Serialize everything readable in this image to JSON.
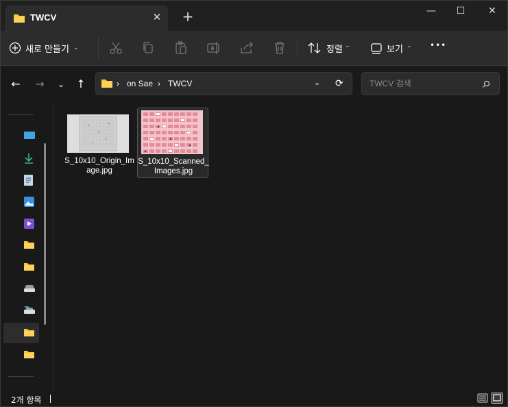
{
  "window": {
    "tab_title": "TWCV",
    "tab_close": "✕",
    "new_tab": "+",
    "minimize": "—",
    "maximize": "☐",
    "close": "✕"
  },
  "toolbar": {
    "new_label": "새로 만들기",
    "sort_label": "정렬",
    "view_label": "보기",
    "more_label": "•••"
  },
  "address": {
    "crumbs": [
      "on Sae",
      "TWCV"
    ]
  },
  "search": {
    "placeholder": "TWCV 검색"
  },
  "files": [
    {
      "name": "S_10x10_Origin_Image.jpg"
    },
    {
      "name": "S_10x10_Scanned_Images.jpg"
    }
  ],
  "status": {
    "item_count": "2개 항목"
  },
  "colors": {
    "folder": "#f8c33e",
    "accent": "#4fa3f7",
    "background": "#191919",
    "toolbar": "#2c2c2c"
  },
  "icons": {
    "nav": [
      "desktop-icon",
      "download-icon",
      "documents-icon",
      "pictures-icon",
      "videos-icon",
      "folder-icon",
      "folder-icon",
      "drive-icon",
      "network-drive-icon",
      "folder-icon",
      "folder-icon"
    ]
  }
}
